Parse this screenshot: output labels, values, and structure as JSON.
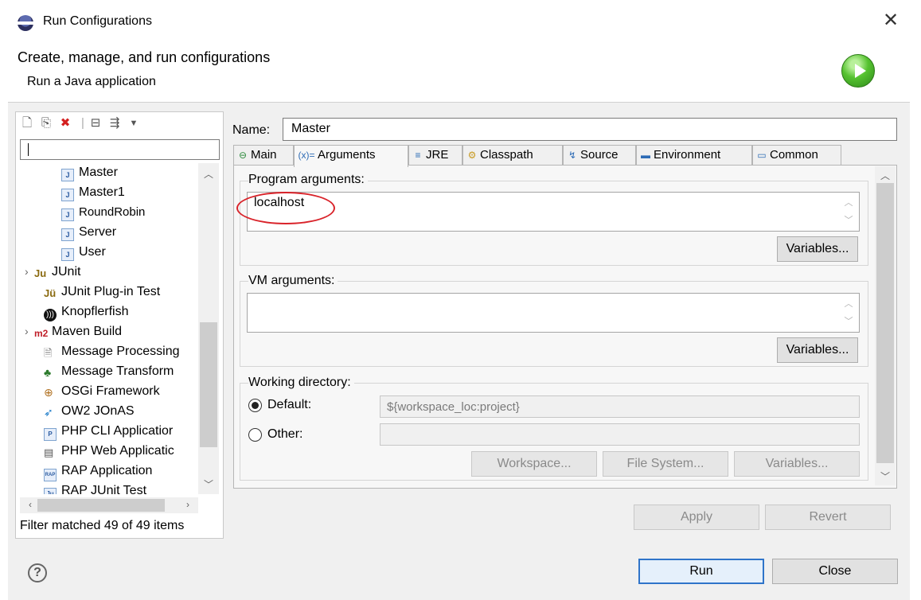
{
  "window": {
    "title": "Run Configurations",
    "close_glyph": "✕"
  },
  "header": {
    "title": "Create, manage, and run configurations",
    "subtitle": "Run a Java application"
  },
  "left": {
    "toolbar_icons": [
      "new-configuration-icon",
      "duplicate-icon",
      "delete-icon",
      "collapse-all-icon",
      "filter-icon",
      "view-menu-icon"
    ],
    "filter_value": "",
    "items": [
      {
        "label": "Master",
        "icon": "java-app-icon",
        "selected": false
      },
      {
        "label": "Master1",
        "icon": "java-app-icon"
      },
      {
        "label": "RoundRobin",
        "icon": "java-app-icon"
      },
      {
        "label": "Server",
        "icon": "java-app-icon"
      },
      {
        "label": "User",
        "icon": "java-app-icon"
      },
      {
        "label": "JUnit",
        "icon": "junit-icon",
        "expandable": true
      },
      {
        "label": "JUnit Plug-in Test",
        "icon": "junit-plugin-icon"
      },
      {
        "label": "Knopflerfish",
        "icon": "knopflerfish-icon"
      },
      {
        "label": "Maven Build",
        "icon": "maven-icon",
        "expandable": true
      },
      {
        "label": "Message Processing",
        "icon": "message-processing-icon"
      },
      {
        "label": "Message Transform",
        "icon": "message-transform-icon"
      },
      {
        "label": "OSGi Framework",
        "icon": "osgi-icon"
      },
      {
        "label": "OW2 JOnAS",
        "icon": "jonas-icon"
      },
      {
        "label": "PHP CLI Applicatior",
        "icon": "php-cli-icon"
      },
      {
        "label": "PHP Web Applicatic",
        "icon": "php-web-icon"
      },
      {
        "label": "RAP Application",
        "icon": "rap-icon"
      },
      {
        "label": "RAP JUnit Test",
        "icon": "rap-junit-icon"
      }
    ],
    "filter_status": "Filter matched 49 of 49 items"
  },
  "config": {
    "name_label": "Name:",
    "name_value": "Master",
    "tabs": [
      {
        "label": "Main",
        "icon": "main-tab-icon"
      },
      {
        "label": "Arguments",
        "icon": "arguments-tab-icon",
        "active": true
      },
      {
        "label": "JRE",
        "icon": "jre-tab-icon"
      },
      {
        "label": "Classpath",
        "icon": "classpath-tab-icon"
      },
      {
        "label": "Source",
        "icon": "source-tab-icon"
      },
      {
        "label": "Environment",
        "icon": "environment-tab-icon"
      },
      {
        "label": "Common",
        "icon": "common-tab-icon"
      }
    ],
    "program_args_label": "Program arguments:",
    "program_args_value": "localhost",
    "vm_args_label": "VM arguments:",
    "vm_args_value": "",
    "variables_label": "Variables...",
    "working_dir_label": "Working directory:",
    "default_label": "Default:",
    "default_value": "${workspace_loc:project}",
    "other_label": "Other:",
    "workspace_label": "Workspace...",
    "filesystem_label": "File System...",
    "apply_label": "Apply",
    "revert_label": "Revert"
  },
  "footer": {
    "run_label": "Run",
    "close_label": "Close"
  },
  "colors": {
    "highlight": "#d9232a",
    "accent": "#2f74c9"
  }
}
